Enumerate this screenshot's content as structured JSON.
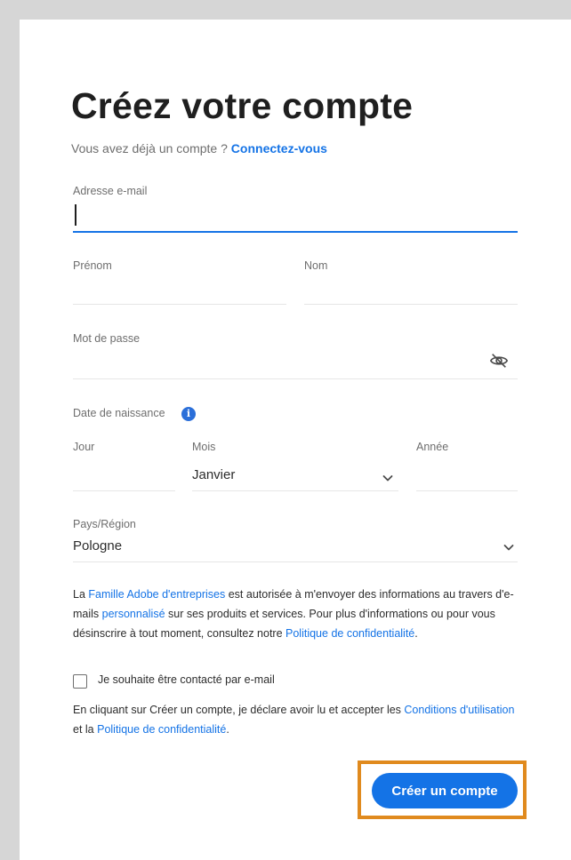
{
  "title": "Créez votre compte",
  "signin": {
    "prompt": "Vous avez déjà un compte ?",
    "link": "Connectez-vous"
  },
  "fields": {
    "email": {
      "label": "Adresse e-mail",
      "value": ""
    },
    "firstname": {
      "label": "Prénom",
      "value": ""
    },
    "lastname": {
      "label": "Nom",
      "value": ""
    },
    "password": {
      "label": "Mot de passe",
      "value": ""
    },
    "birthdate": {
      "label": "Date de naissance",
      "day": {
        "label": "Jour",
        "value": ""
      },
      "month": {
        "label": "Mois",
        "value": "Janvier"
      },
      "year": {
        "label": "Année",
        "value": ""
      }
    },
    "country": {
      "label": "Pays/Région",
      "value": "Pologne"
    }
  },
  "consent": {
    "p1_a": "La ",
    "p1_link1": "Famille Adobe d'entreprises",
    "p1_b": " est autorisée à m'envoyer des informations au travers d'e-mails ",
    "p1_link2": "personnalisé",
    "p1_c": " sur ses produits et services. Pour plus d'informations ou pour vous désinscrire à tout moment, consultez notre ",
    "p1_link3": "Politique de confidentialité",
    "p1_d": ".",
    "checkbox_label": "Je souhaite être contacté par e-mail",
    "checkbox_checked": false,
    "p2_a": "En cliquant sur Créer un compte, je déclare avoir lu et accepter les ",
    "p2_link1": "Conditions d'utilisation",
    "p2_b": " et la ",
    "p2_link2": "Politique de confidentialité",
    "p2_c": "."
  },
  "submit_label": "Créer un compte",
  "icons": {
    "password_toggle": "eye-off-icon",
    "info": "info-icon",
    "dropdown": "chevron-down-icon"
  },
  "colors": {
    "accent": "#1473e6",
    "highlight": "#e08a1e"
  }
}
